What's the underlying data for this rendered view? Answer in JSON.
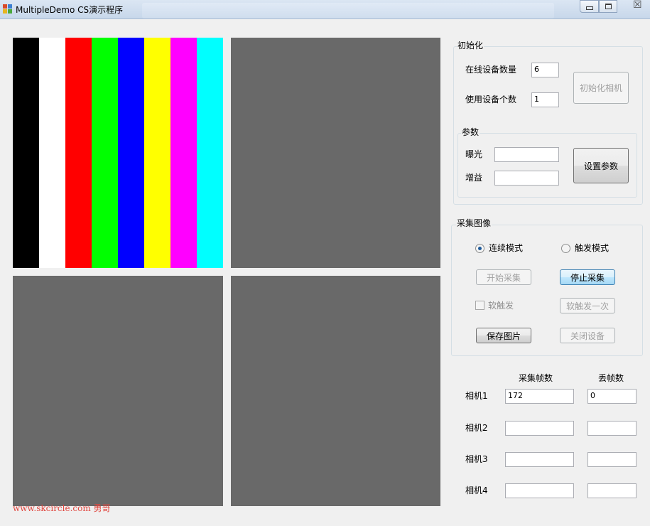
{
  "window": {
    "title": "MultipleDemo CS演示程序",
    "minimize_icon": "minimize-icon",
    "maximize_icon": "maximize-icon",
    "close_glyph": "☒"
  },
  "preview": {
    "color_bars": [
      "#000000",
      "#ffffff",
      "#ff0000",
      "#00ff00",
      "#0000ff",
      "#ffff00",
      "#ff00ff",
      "#00ffff"
    ],
    "pane_color": "#696969"
  },
  "init_group": {
    "title": "初始化",
    "online_devices_label": "在线设备数量",
    "online_devices_value": "6",
    "use_devices_label": "使用设备个数",
    "use_devices_value": "1",
    "init_button": "初始化相机"
  },
  "params_group": {
    "title": "参数",
    "exposure_label": "曝光",
    "exposure_value": "",
    "gain_label": "增益",
    "gain_value": "",
    "set_button": "设置参数"
  },
  "capture_group": {
    "title": "采集图像",
    "continuous_mode": "连续模式",
    "trigger_mode": "触发模式",
    "selected_mode": "连续模式",
    "start_button": "开始采集",
    "stop_button": "停止采集",
    "soft_trigger_checkbox": "软触发",
    "soft_trigger_once_button": "软触发一次",
    "save_image_button": "保存图片",
    "close_device_button": "关闭设备"
  },
  "stats": {
    "col_frames": "采集帧数",
    "col_lost": "丢帧数",
    "rows": [
      {
        "camera": "相机1",
        "frames": "172",
        "lost": "0"
      },
      {
        "camera": "相机2",
        "frames": "",
        "lost": ""
      },
      {
        "camera": "相机3",
        "frames": "",
        "lost": ""
      },
      {
        "camera": "相机4",
        "frames": "",
        "lost": ""
      }
    ]
  },
  "watermark": "www.skcircle.com 勇哥"
}
